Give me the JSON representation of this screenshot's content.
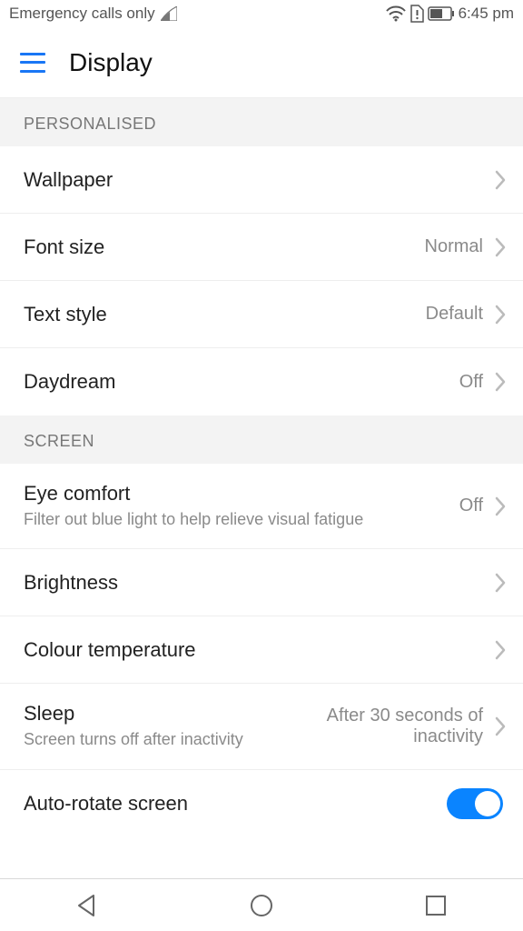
{
  "status": {
    "carrier": "Emergency calls only",
    "time": "6:45 pm"
  },
  "header": {
    "title": "Display"
  },
  "sections": {
    "personalised": {
      "label": "PERSONALISED",
      "wallpaper": "Wallpaper",
      "font_size": {
        "label": "Font size",
        "value": "Normal"
      },
      "text_style": {
        "label": "Text style",
        "value": "Default"
      },
      "daydream": {
        "label": "Daydream",
        "value": "Off"
      }
    },
    "screen": {
      "label": "SCREEN",
      "eye_comfort": {
        "label": "Eye comfort",
        "sub": "Filter out blue light to help relieve visual fatigue",
        "value": "Off"
      },
      "brightness": "Brightness",
      "colour_temp": "Colour temperature",
      "sleep": {
        "label": "Sleep",
        "sub": "Screen turns off after inactivity",
        "value": "After 30 seconds of inactivity"
      },
      "auto_rotate": {
        "label": "Auto-rotate screen",
        "on": true
      }
    }
  }
}
